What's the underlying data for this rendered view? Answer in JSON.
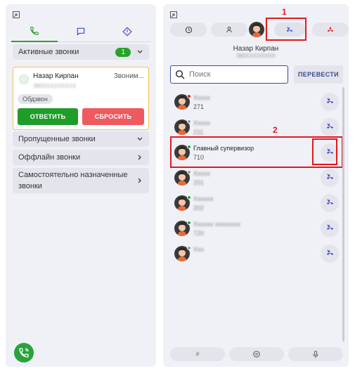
{
  "left": {
    "tabs": [
      {
        "name": "phone-icon",
        "active": true
      },
      {
        "name": "chat-icon",
        "active": false
      },
      {
        "name": "tickets-icon",
        "active": false
      }
    ],
    "active_calls": {
      "label": "Активные звонки",
      "count": "1"
    },
    "incoming_call": {
      "name": "Назар Кирпан",
      "number": "380XXXXXXXXX",
      "status": "Звоним...",
      "tag": "Обдзвон",
      "answer_label": "ОТВЕТИТЬ",
      "reset_label": "СБРОСИТЬ"
    },
    "missed_calls": "Пропущенные звонки",
    "offline_calls": "Оффлайн звонки",
    "self_assigned": "Самостоятельно назначенные звонки"
  },
  "right": {
    "toolbar": [
      "history-icon",
      "user-icon",
      "avatar",
      "transfer-icon",
      "hangup-icon"
    ],
    "me": {
      "name": "Назар Кирпан",
      "number": "380XXXXXXXX"
    },
    "search_placeholder": "Поиск",
    "transfer_label": "ПЕРЕВЕСТИ",
    "annotations": {
      "one": "1",
      "two": "2"
    },
    "contacts": [
      {
        "name": "Ххххх",
        "ext": "271",
        "status": "red",
        "blurred_name": true,
        "blurred_ext": false
      },
      {
        "name": "Ххххх",
        "ext": "211",
        "status": "gray",
        "blurred_name": true,
        "blurred_ext": true
      },
      {
        "name": "Главный супервизор",
        "ext": "710",
        "status": "green",
        "blurred_name": false,
        "blurred_ext": false
      },
      {
        "name": "Ххххх",
        "ext": "201",
        "status": "gray",
        "blurred_name": true,
        "blurred_ext": true
      },
      {
        "name": "Хххххх",
        "ext": "202",
        "status": "green",
        "blurred_name": true,
        "blurred_ext": true
      },
      {
        "name": "Хххххх хххххххх",
        "ext": "720",
        "status": "green",
        "blurred_name": true,
        "blurred_ext": true
      },
      {
        "name": "Ххх",
        "ext": "",
        "status": "gray",
        "blurred_name": true,
        "blurred_ext": true
      }
    ],
    "bottom": [
      "#",
      "hold-icon",
      "mic-icon"
    ]
  },
  "colors": {
    "green": "#27a43a",
    "red": "#e0191f",
    "accent_blue": "#3a4ad0",
    "gray_dot": "#9a9a9a"
  }
}
